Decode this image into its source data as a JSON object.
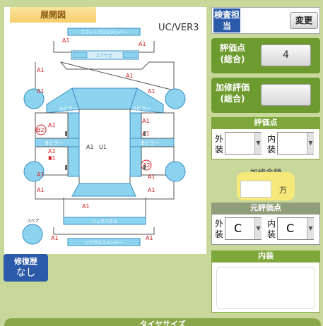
{
  "left": {
    "tab_label": "展開図",
    "version": "UC/VER3",
    "repair_history_label": "修復歴",
    "repair_history_value": "なし"
  },
  "diagram": {
    "part_labels": {
      "front_cross_member": "フロントクロスメンバー",
      "core_support": "コアサポ",
      "a_pillar_left": "Aピラー",
      "a_pillar_right": "Aピラー",
      "b_pillar_left": "Bピラー",
      "b_pillar_right": "Bピラー",
      "back_panel": "バックパネル",
      "rear_cross_member": "リアクロスメンバー",
      "spare": "スペア"
    },
    "marks": [
      "A1",
      "A1",
      "A1",
      "A1",
      "A1",
      "A1",
      "A1",
      "B2",
      "A1",
      "A1",
      "B1",
      "A1",
      "U1",
      "A1",
      "A2",
      "A1",
      "A1",
      "A1",
      "A1",
      "A1",
      "A1",
      "A1"
    ]
  },
  "right": {
    "inspector_label": "検査担当",
    "change_button": "変更",
    "score_label": "評価点(総合)",
    "score_value": "4",
    "repair_eval_label": "加修評価(総合)",
    "repair_eval_value": "",
    "eval_section_title": "評価点",
    "exterior_label": "外装",
    "interior_label_short": "内装",
    "repair_amount_label": "加修金額",
    "repair_amount_unit": "万",
    "orig_section_title": "元評価点",
    "orig_exterior_value": "C",
    "orig_interior_value": "C",
    "interior_section_title": "内装"
  },
  "bottom": {
    "title": "タイヤサイズ"
  }
}
